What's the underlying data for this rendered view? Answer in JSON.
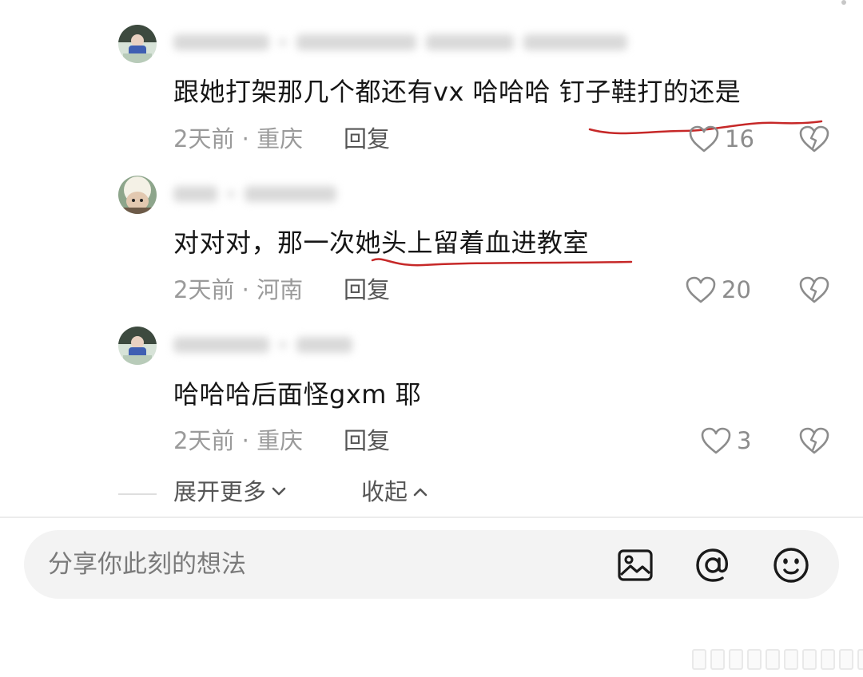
{
  "comments": [
    {
      "text": "跟她打架那几个都还有vx 哈哈哈 钉子鞋打的还是",
      "time": "2天前",
      "location": "重庆",
      "reply_label": "回复",
      "likes": "16"
    },
    {
      "text": "对对对，那一次她头上留着血进教室",
      "time": "2天前",
      "location": "河南",
      "reply_label": "回复",
      "likes": "20"
    },
    {
      "text": "哈哈哈后面怪gxm 耶",
      "time": "2天前",
      "location": "重庆",
      "reply_label": "回复",
      "likes": "3"
    }
  ],
  "thread_controls": {
    "expand_label": "展开更多",
    "collapse_label": "收起"
  },
  "input_bar": {
    "placeholder": "分享你此刻的想法"
  },
  "icons": {
    "like": "heart-outline-icon",
    "dislike": "broken-heart-icon",
    "image": "image-icon",
    "mention": "at-icon",
    "emoji": "emoji-icon",
    "expand": "chevron-down-icon",
    "collapse": "chevron-up-icon"
  },
  "colors": {
    "annotation_underline": "#c62828",
    "meta_text": "#9a9a9a",
    "input_bg": "#f3f3f3"
  }
}
